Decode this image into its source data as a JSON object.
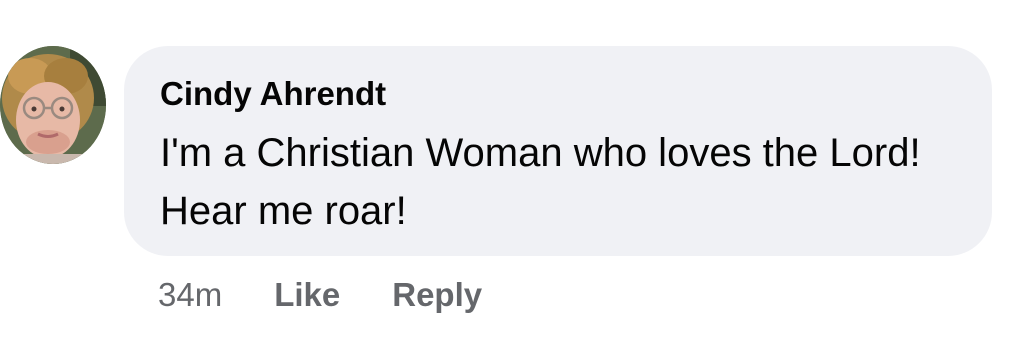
{
  "comment": {
    "author": "Cindy Ahrendt",
    "text": "I'm a Christian Woman who loves the Lord! Hear me roar!",
    "timestamp": "34m",
    "actions": {
      "like_label": "Like",
      "reply_label": "Reply"
    },
    "colors": {
      "bubble_background": "#f0f1f5",
      "name_text": "#050505",
      "meta_text": "#65676b"
    }
  }
}
